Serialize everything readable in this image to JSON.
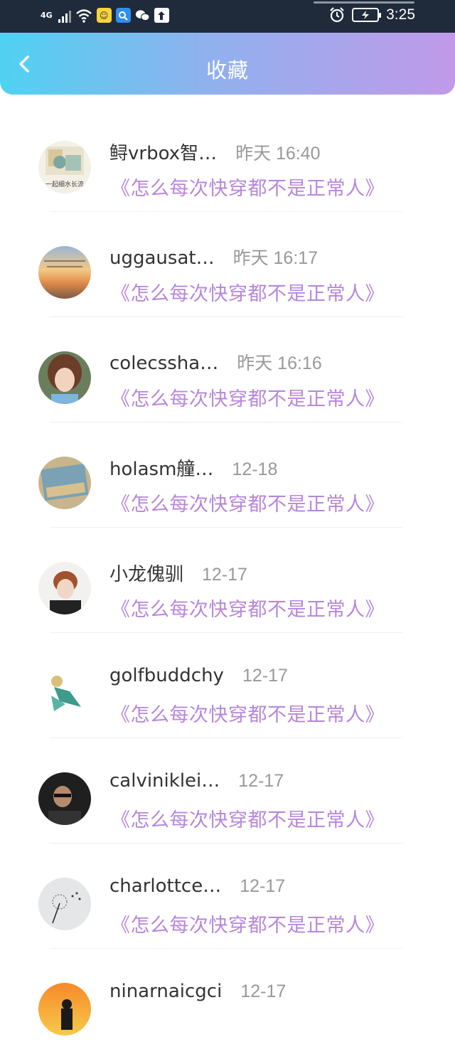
{
  "status_bar": {
    "network": "4G",
    "time": "3:25"
  },
  "header": {
    "title": "收藏"
  },
  "favorites": [
    {
      "name": "鲟vrbox智…",
      "time": "昨天 16:40",
      "title": "《怎么每次快穿都不是正常人》",
      "avatar_text": "一起细水长流"
    },
    {
      "name": "uggausat…",
      "time": "昨天 16:17",
      "title": "《怎么每次快穿都不是正常人》",
      "avatar_text": ""
    },
    {
      "name": "colecssha…",
      "time": "昨天 16:16",
      "title": "《怎么每次快穿都不是正常人》",
      "avatar_text": ""
    },
    {
      "name": "holasm艟…",
      "time": "12-18",
      "title": "《怎么每次快穿都不是正常人》",
      "avatar_text": ""
    },
    {
      "name": "小龙傀驯",
      "time": "12-17",
      "title": "《怎么每次快穿都不是正常人》",
      "avatar_text": ""
    },
    {
      "name": "golfbuddchy",
      "time": "12-17",
      "title": "《怎么每次快穿都不是正常人》",
      "avatar_text": ""
    },
    {
      "name": "calviniklei…",
      "time": "12-17",
      "title": "《怎么每次快穿都不是正常人》",
      "avatar_text": ""
    },
    {
      "name": "charlottce…",
      "time": "12-17",
      "title": "《怎么每次快穿都不是正常人》",
      "avatar_text": ""
    },
    {
      "name": "ninarnaicgci",
      "time": "12-17",
      "title": "",
      "avatar_text": ""
    }
  ],
  "colors": {
    "accent_text": "#b786dc",
    "header_gradient_start": "#4fd2f2",
    "header_gradient_end": "#c09ae9"
  }
}
